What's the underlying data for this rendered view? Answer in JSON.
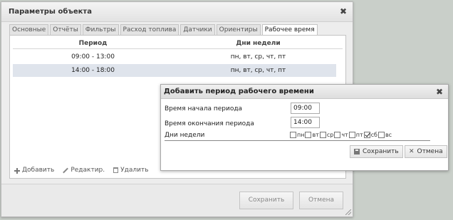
{
  "main_window": {
    "title": "Параметры объекта",
    "close_glyph": "✖",
    "tabs": [
      {
        "label": "Основные",
        "active": false
      },
      {
        "label": "Отчёты",
        "active": false
      },
      {
        "label": "Фильтры",
        "active": false
      },
      {
        "label": "Расход топлива",
        "active": false
      },
      {
        "label": "Датчики",
        "active": false
      },
      {
        "label": "Ориентиры",
        "active": false
      },
      {
        "label": "Рабочее время",
        "active": true
      }
    ],
    "table": {
      "columns": [
        "Период",
        "Дни недели"
      ],
      "rows": [
        {
          "period": "09:00 - 13:00",
          "days": "пн, вт, ср, чт, пт",
          "selected": false
        },
        {
          "period": "14:00 - 18:00",
          "days": "пн, вт, ср, чт, пт",
          "selected": true
        }
      ]
    },
    "toolbar": {
      "add": "Добавить",
      "edit": "Редактир.",
      "delete": "Удалить"
    },
    "footer": {
      "save": "Сохранить",
      "cancel": "Отмена"
    }
  },
  "dialog": {
    "title": "Добавить период рабочего времени",
    "close_glyph": "✖",
    "start_label": "Время начала периода",
    "start_value": "09:00",
    "end_label": "Время окончания периода",
    "end_value": "14:00",
    "days_label": "Дни недели",
    "days": [
      {
        "label": "пн",
        "checked": false
      },
      {
        "label": "вт",
        "checked": false
      },
      {
        "label": "ср",
        "checked": false
      },
      {
        "label": "чт",
        "checked": false
      },
      {
        "label": "пт",
        "checked": false
      },
      {
        "label": "сб",
        "checked": true
      },
      {
        "label": "вс",
        "checked": false
      }
    ],
    "save": "Сохранить",
    "cancel": "Отмена"
  },
  "colors": {
    "background": "#c9cfc9",
    "selected_row": "#dfe4ec",
    "window": "#ededed"
  }
}
